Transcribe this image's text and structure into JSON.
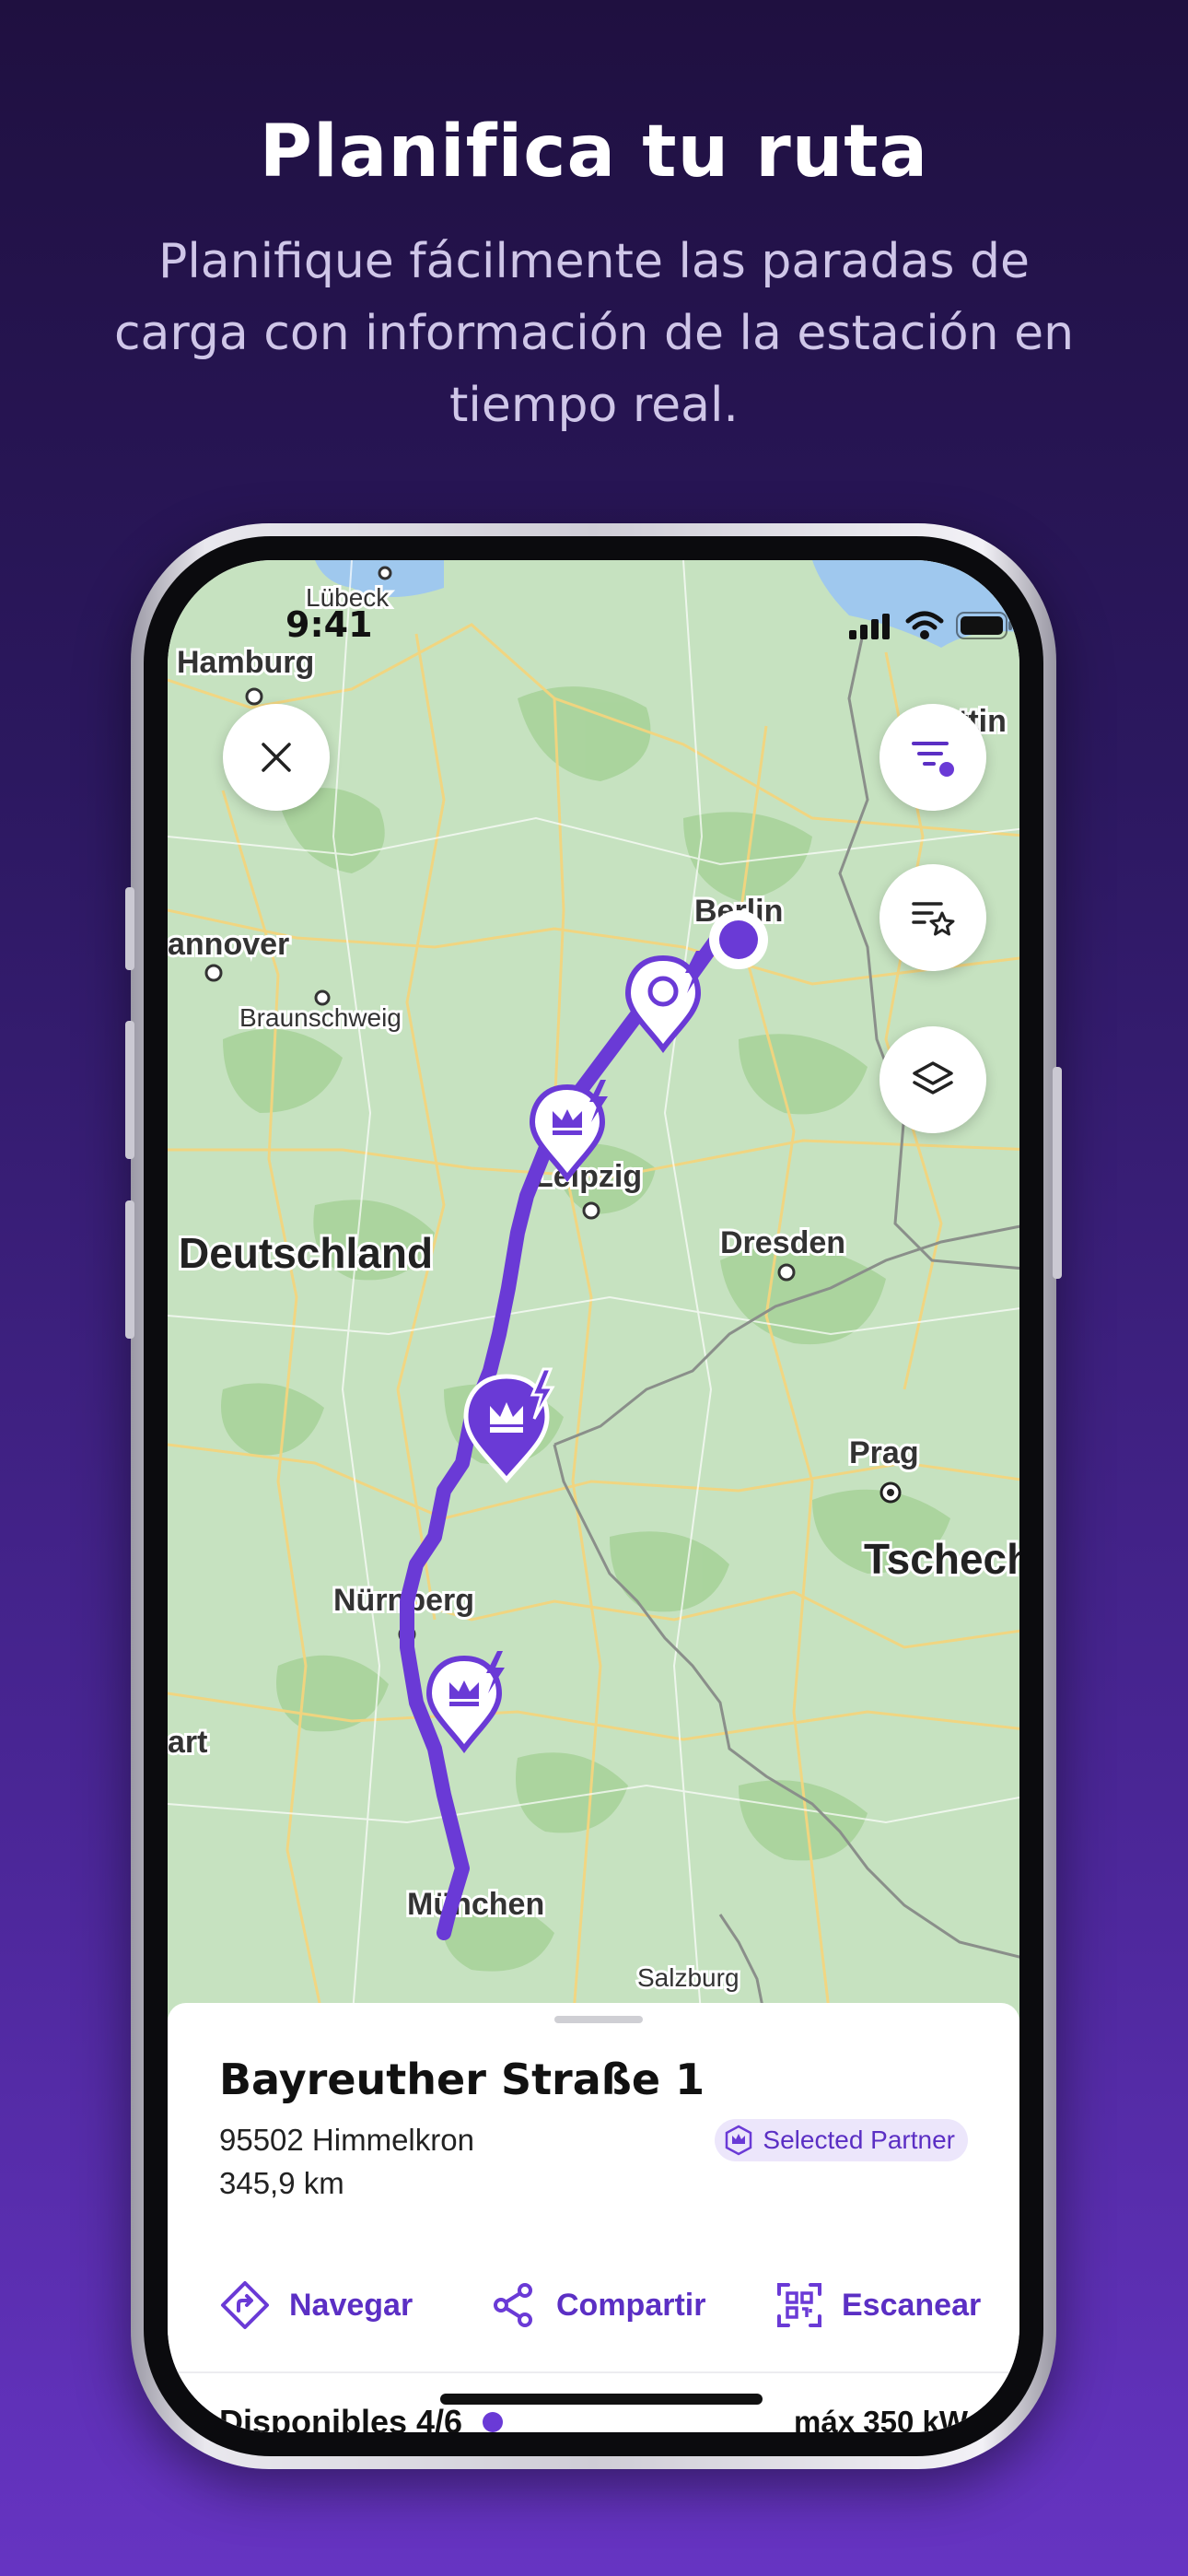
{
  "promo": {
    "title": "Planifica tu ruta",
    "subtitle": "Planifique fácilmente las paradas de carga con información de la estación en tiempo real."
  },
  "status": {
    "time": "9:41"
  },
  "map": {
    "labels": {
      "lubeck": "Lübeck",
      "hamburg": "Hamburg",
      "stettin": "ttin",
      "hannover": "annover",
      "braunschweig": "Braunschweig",
      "berlin": "Berlin",
      "leipzig": "Leipzig",
      "dresden": "Dresden",
      "deutschland": "Deutschland",
      "prag": "Prag",
      "tschech": "Tschech",
      "nurnberg": "Nürnberg",
      "stuttgart": "art",
      "munchen": "München",
      "salzburg": "Salzburg"
    },
    "accent": "#6a3ad6"
  },
  "controls": {
    "close_icon": "close-icon",
    "filter_icon": "filter-icon",
    "favorites_icon": "favorites-icon",
    "layers_icon": "layers-icon"
  },
  "station": {
    "name": "Bayreuther Straße 1",
    "address": "95502 Himmelkron",
    "distance": "345,9 km",
    "badge": "Selected Partner"
  },
  "actions": {
    "navigate": "Navegar",
    "share": "Compartir",
    "scan": "Escanear"
  },
  "availability": {
    "label": "Disponibles 4/6",
    "max_power": "máx 350 kW"
  }
}
